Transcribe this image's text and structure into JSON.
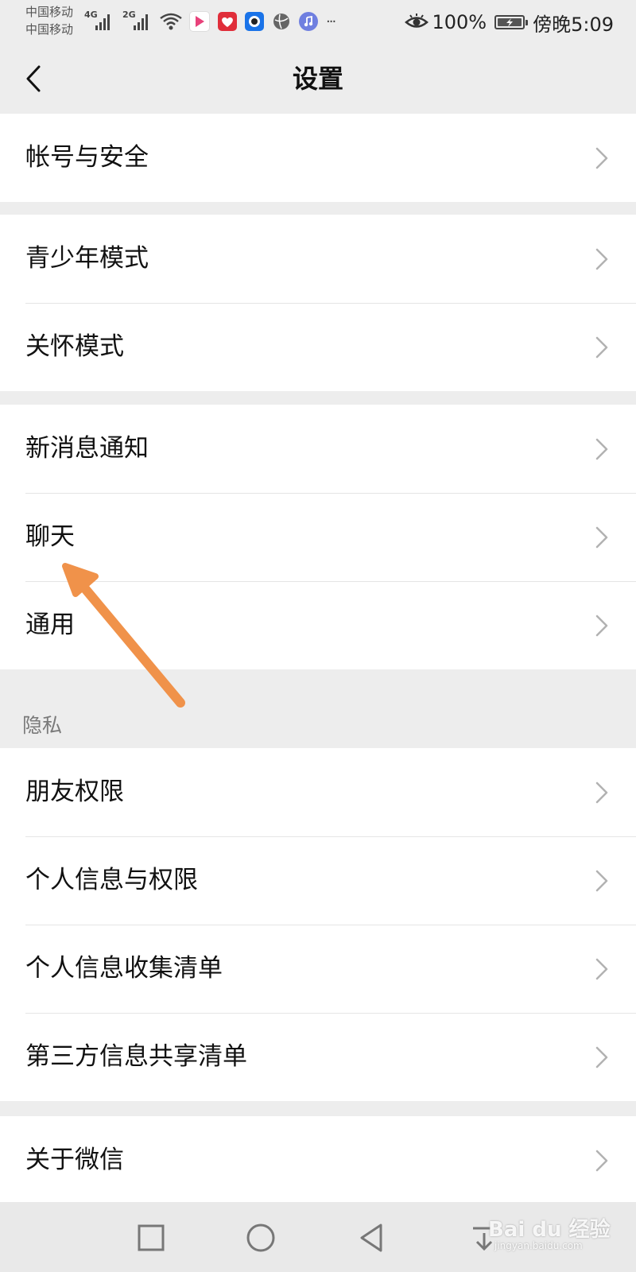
{
  "status_bar": {
    "carrier_1": "中国移动",
    "carrier_2": "中国移动",
    "network_1": "4G",
    "network_2": "2G",
    "battery_percent": "100%",
    "time": "傍晚5:09",
    "more_indicator": "···",
    "icons": [
      "eye-icon",
      "wifi-icon",
      "battery-charging-icon"
    ]
  },
  "header": {
    "title": "设置",
    "back_icon": "chevron-left-icon"
  },
  "groups": [
    {
      "items": [
        {
          "label": "帐号与安全"
        }
      ]
    },
    {
      "items": [
        {
          "label": "青少年模式"
        },
        {
          "label": "关怀模式"
        }
      ]
    },
    {
      "items": [
        {
          "label": "新消息通知"
        },
        {
          "label": "聊天"
        },
        {
          "label": "通用"
        }
      ]
    },
    {
      "header": "隐私",
      "items": [
        {
          "label": "朋友权限"
        },
        {
          "label": "个人信息与权限"
        },
        {
          "label": "个人信息收集清单"
        },
        {
          "label": "第三方信息共享清单"
        }
      ]
    },
    {
      "items": [
        {
          "label": "关于微信"
        }
      ]
    }
  ],
  "row_icon": "chevron-right-icon",
  "nav_bar": {
    "buttons": [
      "recents-square-icon",
      "home-circle-icon",
      "back-triangle-icon",
      "download-icon"
    ]
  },
  "annotation": {
    "color": "#f0924a",
    "points_to": "聊天"
  },
  "watermark": {
    "main": "Bai du 经验",
    "sub": "jingyan.baidu.com"
  },
  "colors": {
    "background": "#ededed",
    "row_background": "#ffffff",
    "text": "#111111",
    "divider": "#e5e5e5",
    "chevron": "#b2b2b2",
    "section_header": "#7a7a7a"
  }
}
